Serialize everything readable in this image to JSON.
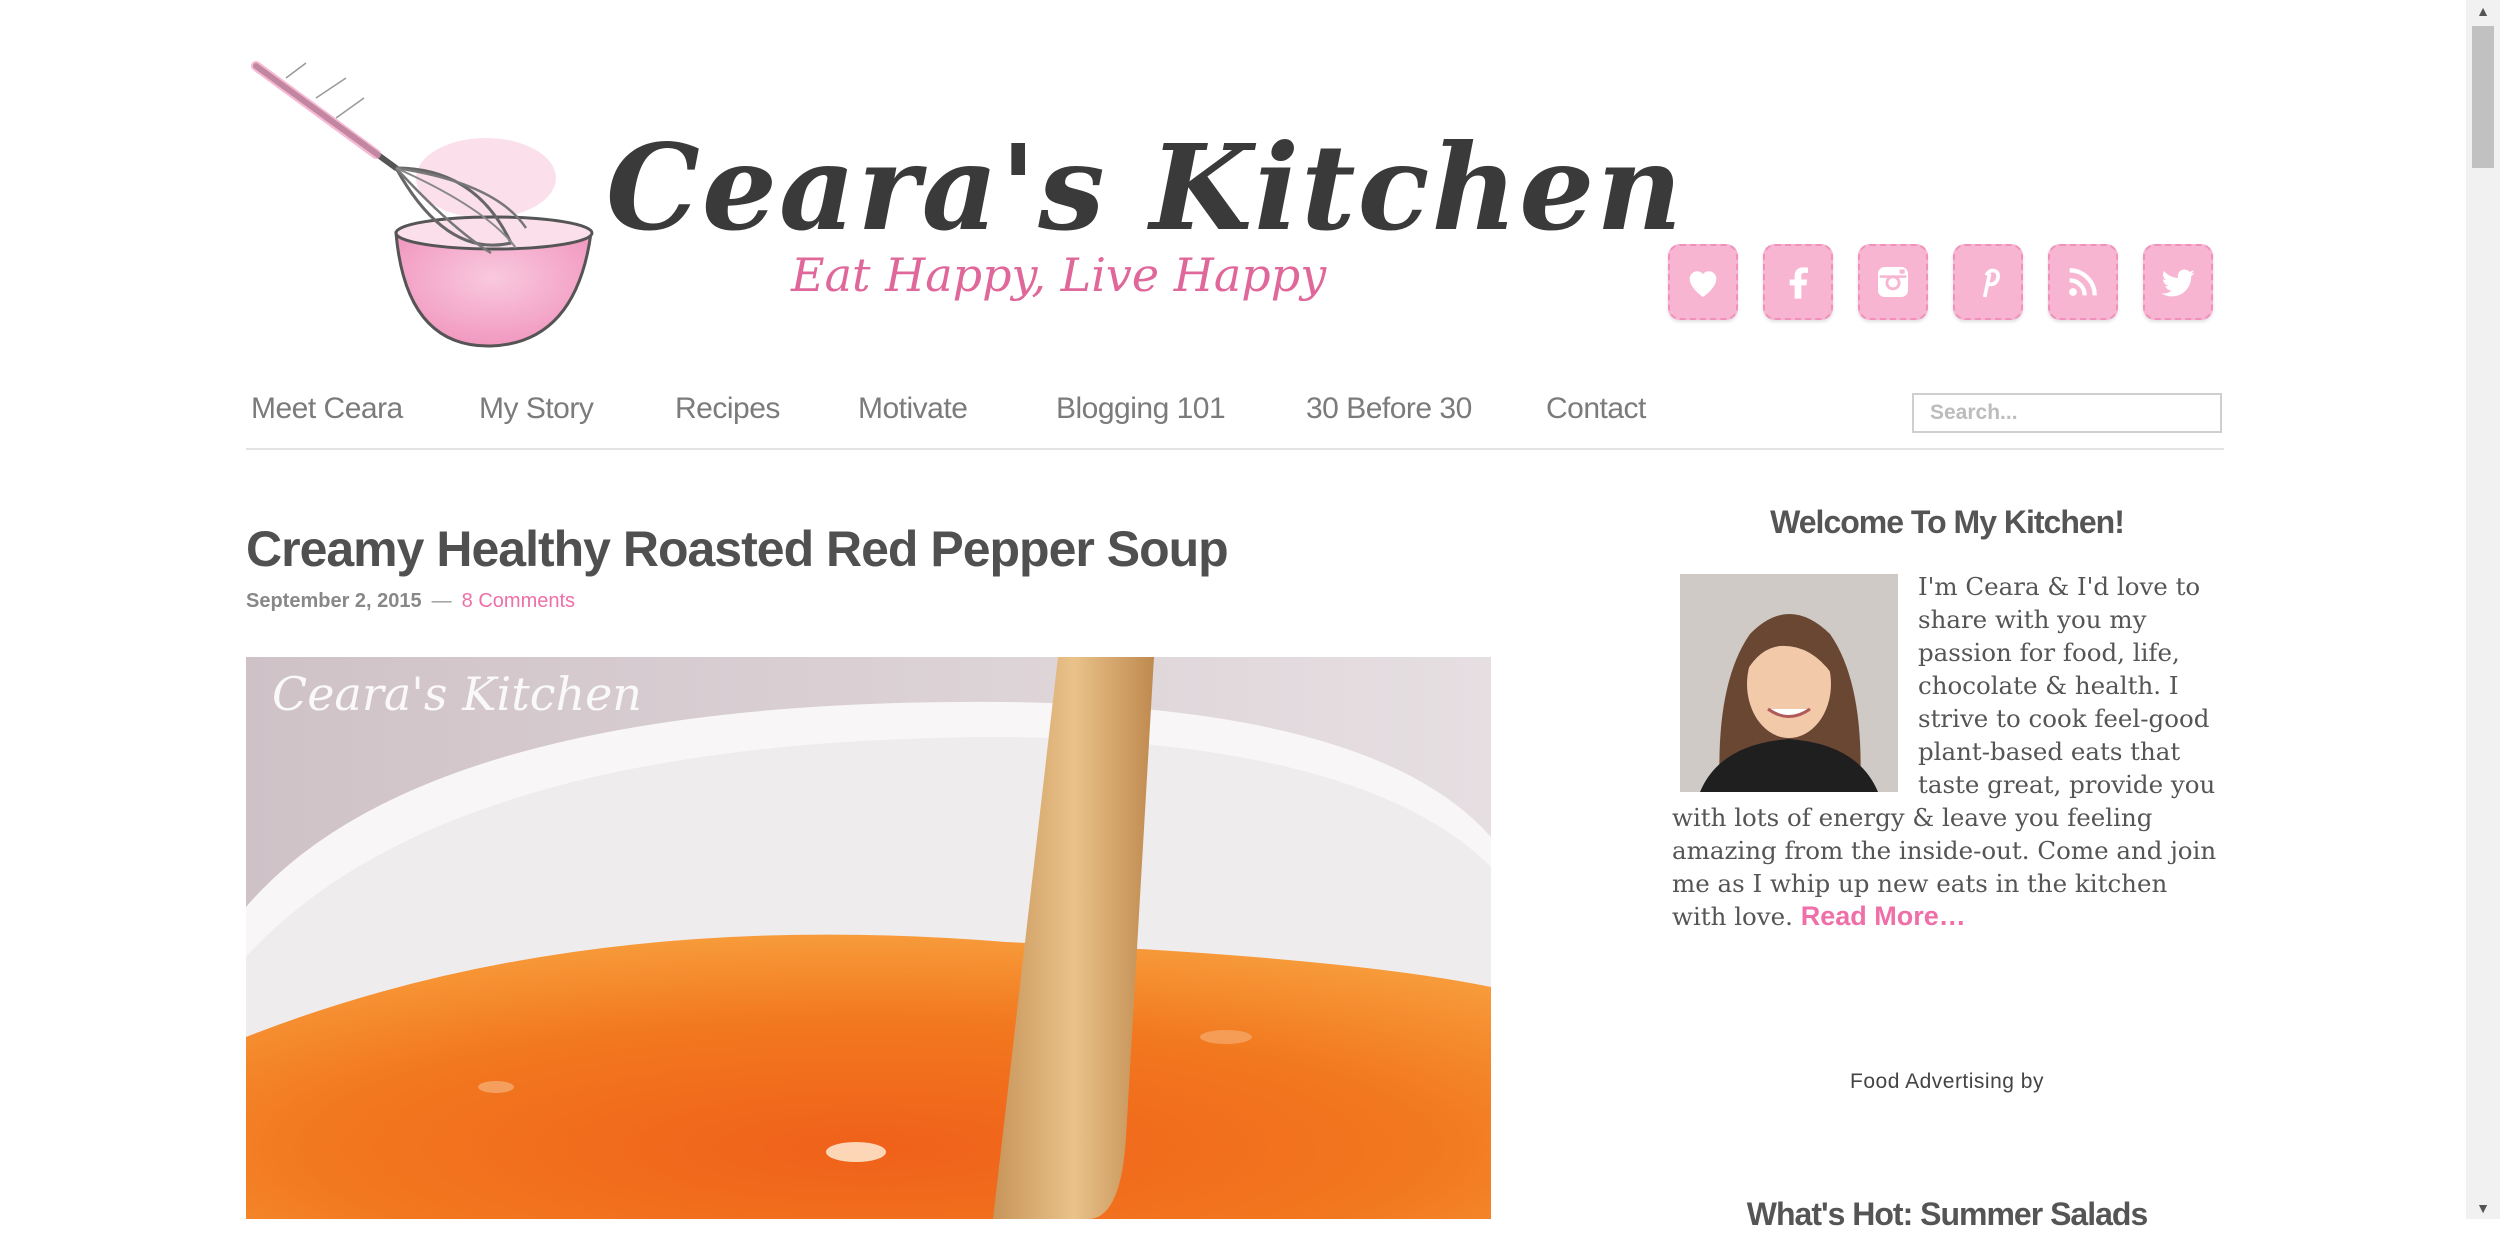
{
  "header": {
    "logo_title": "Ceara's Kitchen",
    "logo_tagline": "Eat Happy, Live Happy",
    "social": [
      {
        "name": "bloglovin",
        "icon": "heart-icon"
      },
      {
        "name": "facebook",
        "icon": "facebook-icon"
      },
      {
        "name": "instagram",
        "icon": "instagram-icon"
      },
      {
        "name": "pinterest",
        "icon": "pinterest-icon"
      },
      {
        "name": "rss",
        "icon": "rss-icon"
      },
      {
        "name": "twitter",
        "icon": "twitter-icon"
      }
    ],
    "social_color": "#f7b5d2"
  },
  "nav": {
    "items": [
      "Meet Ceara",
      "My Story",
      "Recipes",
      "Motivate",
      "Blogging 101",
      "30 Before 30",
      "Contact"
    ],
    "search_placeholder": "Search..."
  },
  "post": {
    "title": "Creamy Healthy Roasted Red Pepper Soup",
    "date": "September 2, 2015",
    "separator": "—",
    "comments": "8 Comments",
    "image_watermark": "Ceara's Kitchen"
  },
  "sidebar": {
    "welcome_title": "Welcome To My Kitchen!",
    "bio": "I'm Ceara & I'd love to share with you my passion for food, life, chocolate & health. I strive to cook feel-good plant-based eats that taste great, provide you with lots of energy & leave you feeling amazing from the inside-out. Come and join me as I whip up new eats in the kitchen with love.",
    "read_more": "Read More…",
    "ad_label": "Food Advertising by",
    "next_widget_title": "What's Hot: Summer Salads"
  },
  "colors": {
    "accent_pink": "#ef6fa8",
    "text_gray": "#555555"
  }
}
